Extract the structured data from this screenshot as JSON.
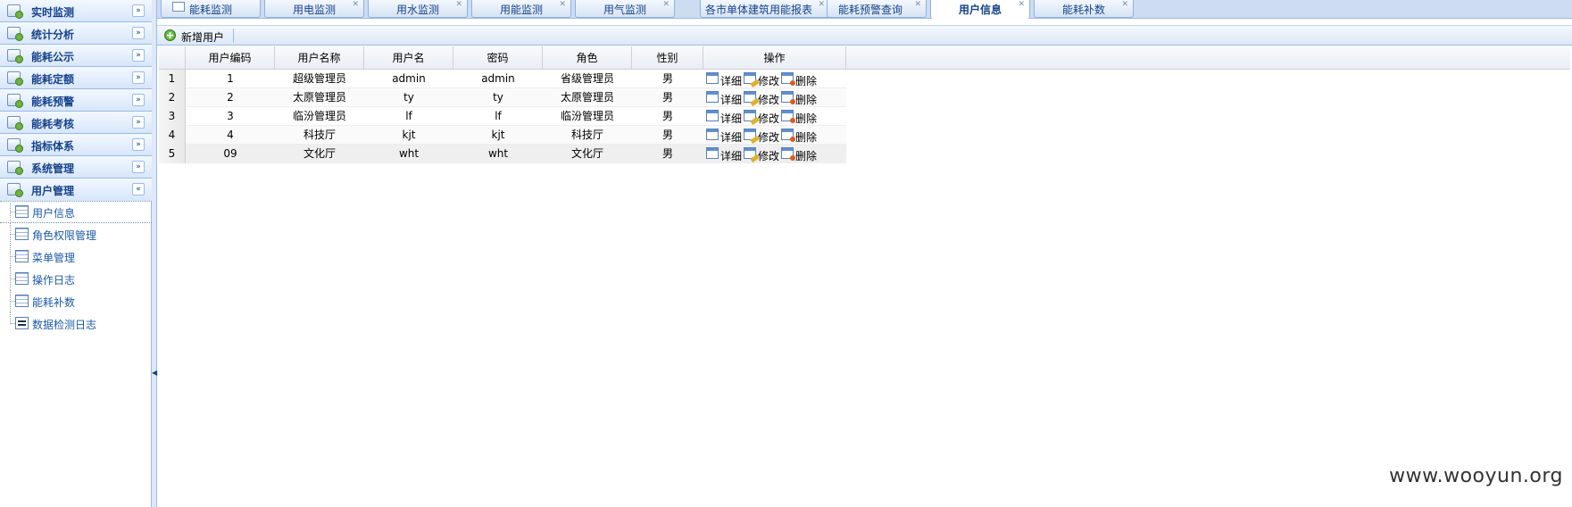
{
  "sidebar": {
    "groups": [
      {
        "label": "实时监测",
        "toggle": "»"
      },
      {
        "label": "统计分析",
        "toggle": "»"
      },
      {
        "label": "能耗公示",
        "toggle": "»"
      },
      {
        "label": "能耗定额",
        "toggle": "»"
      },
      {
        "label": "能耗预警",
        "toggle": "»"
      },
      {
        "label": "能耗考核",
        "toggle": "»"
      },
      {
        "label": "指标体系",
        "toggle": "»"
      },
      {
        "label": "系统管理",
        "toggle": "»"
      },
      {
        "label": "用户管理",
        "toggle": "«"
      }
    ],
    "items": [
      {
        "label": "用户信息"
      },
      {
        "label": "角色权限管理"
      },
      {
        "label": "菜单管理"
      },
      {
        "label": "操作日志"
      },
      {
        "label": "能耗补数"
      },
      {
        "label": "数据检测日志"
      }
    ],
    "splitter_glyph": "◀"
  },
  "tabs": [
    {
      "label": "能耗监测",
      "close": ""
    },
    {
      "label": "用电监测",
      "close": "✕"
    },
    {
      "label": "用水监测",
      "close": "✕"
    },
    {
      "label": "用能监测",
      "close": "✕"
    },
    {
      "label": "用气监测",
      "close": "✕"
    },
    {
      "label": "各市单体建筑用能报表",
      "close": "✕"
    },
    {
      "label": "能耗预警查询",
      "close": "✕"
    },
    {
      "label": "用户信息",
      "close": "✕"
    },
    {
      "label": "能耗补数",
      "close": "✕"
    }
  ],
  "toolbar": {
    "add_label": "新增用户",
    "add_icon": "+"
  },
  "grid": {
    "columns": [
      "用户编码",
      "用户名称",
      "用户名",
      "密码",
      "角色",
      "性别",
      "操作"
    ],
    "rows": [
      {
        "n": "1",
        "code": "1",
        "name": "超级管理员",
        "user": "admin",
        "pwd": "admin",
        "role": "省级管理员",
        "sex": "男"
      },
      {
        "n": "2",
        "code": "2",
        "name": "太原管理员",
        "user": "ty",
        "pwd": "ty",
        "role": "太原管理员",
        "sex": "男"
      },
      {
        "n": "3",
        "code": "3",
        "name": "临汾管理员",
        "user": "lf",
        "pwd": "lf",
        "role": "临汾管理员",
        "sex": "男"
      },
      {
        "n": "4",
        "code": "4",
        "name": "科技厅",
        "user": "kjt",
        "pwd": "kjt",
        "role": "科技厅",
        "sex": "男"
      },
      {
        "n": "5",
        "code": "09",
        "name": "文化厅",
        "user": "wht",
        "pwd": "wht",
        "role": "文化厅",
        "sex": "男"
      }
    ],
    "ops": {
      "detail": "详细",
      "edit": "修改",
      "delete": "删除"
    }
  },
  "watermark": "www.wooyun.org"
}
